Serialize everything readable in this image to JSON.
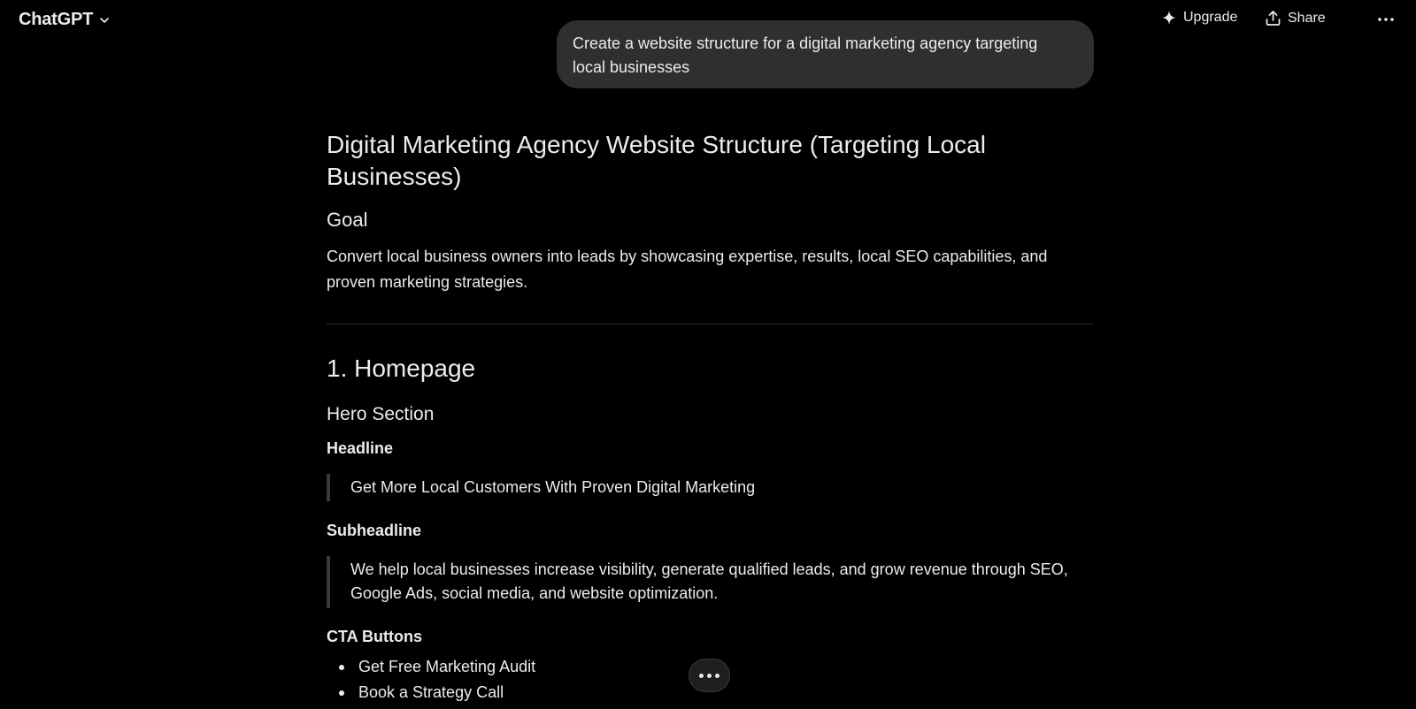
{
  "header": {
    "app_title": "ChatGPT",
    "upgrade_label": "Upgrade",
    "share_label": "Share"
  },
  "conversation": {
    "user_message": "Create a website structure for a digital marketing agency targeting local businesses",
    "response": {
      "title": "Digital Marketing Agency Website Structure (Targeting Local Businesses)",
      "goal_heading": "Goal",
      "goal_text": "Convert local business owners into leads by showcasing expertise, results, local SEO capabilities, and proven marketing strategies.",
      "section_heading": "1. Homepage",
      "subsection_heading": "Hero Section",
      "headline_label": "Headline",
      "headline_quote": "Get More Local Customers With Proven Digital Marketing",
      "subheadline_label": "Subheadline",
      "subheadline_quote": "We help local businesses increase visibility, generate qualified leads, and grow revenue through SEO, Google Ads, social media, and website optimization.",
      "cta_label": "CTA Buttons",
      "cta_items": [
        "Get Free Marketing Audit",
        "Book a Strategy Call"
      ]
    }
  },
  "icons": {
    "model_chevron": "chevron-down-icon",
    "upgrade": "sparkle-icon",
    "share": "share-upload-icon",
    "more": "more-horizontal-icon",
    "floating_more": "ellipsis-icon"
  },
  "colors": {
    "background": "#000000",
    "text": "#ececec",
    "bubble": "#2f2f2f",
    "divider": "#2e2e2e",
    "quote_bar": "#3a3a3a"
  }
}
